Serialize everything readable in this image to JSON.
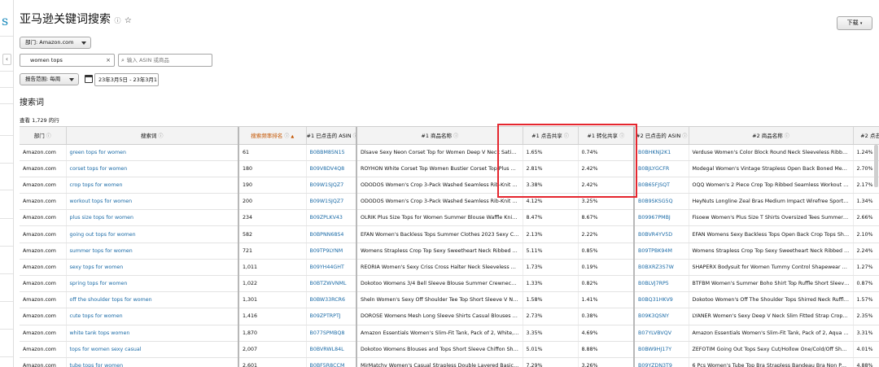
{
  "page": {
    "title": "亚马逊关键词搜索",
    "info_icon": "info-circle-icon",
    "star_icon": "star-outline-icon",
    "download_label": "下载",
    "sidebar_logo": "s"
  },
  "filters": {
    "department_label": "部门: Amazon.com",
    "search_value": "women tops",
    "asin_placeholder": "输入 ASIN 或商品",
    "report_range_label": "报告范围: 每周",
    "date_range": "23年3月5日 - 23年3月1"
  },
  "section": {
    "title": "搜索词",
    "count": "查看 1,729 的行"
  },
  "table": {
    "headers": [
      "部门",
      "搜索词",
      "搜索频率排名",
      "#1 已点击的 ASIN",
      "#1 商品名称",
      "#1 点击共享",
      "#1 转化共享",
      "#2 已点击的 ASIN",
      "#2 商品名称",
      "#2 点击共享"
    ],
    "rows": [
      [
        "Amazon.com",
        "green tops for women",
        "61",
        "B0BBM85N15",
        "Dlsave Sexy Neon Corset Top for Women Deep V Neck Satin B...",
        "1.65%",
        "0.74%",
        "B0BHKNJ2K1",
        "Verduse Women's Color Block Round Neck Sleeveless Ribbed ...",
        "1.24%"
      ],
      [
        "Amazon.com",
        "corset tops for women",
        "180",
        "B09V8DV4Q8",
        "ROYHON White Corset Top Women Bustier Corset Top Plus Si...",
        "2.81%",
        "2.42%",
        "B0BJLYGCFR",
        "Modegal Women's Vintage Strapless Open Back Boned Mesh B...",
        "2.70%"
      ],
      [
        "Amazon.com",
        "crop tops for women",
        "190",
        "B09W1SJQZ7",
        "ODODOS Women's Crop 3-Pack Washed Seamless Rib-Knit Ca...",
        "3.38%",
        "2.42%",
        "B0B65FJSQT",
        "OQQ Women's 2 Piece Crop Top Ribbed Seamless Workout Ex...",
        "2.17%"
      ],
      [
        "Amazon.com",
        "workout tops for women",
        "200",
        "B09W1SJQZ7",
        "ODODOS Women's Crop 3-Pack Washed Seamless Rib-Knit Ca...",
        "4.12%",
        "3.25%",
        "B0B9SKSG5Q",
        "HeyNuts Longline Zeal Bras Medium Impact Wirefree Sports B...",
        "1.34%"
      ],
      [
        "Amazon.com",
        "plus size tops for women",
        "234",
        "B09ZPLKV43",
        "OLRIK Plus Size Tops for Women Summer Blouse Waffle Knit ...",
        "8.47%",
        "8.67%",
        "B09967PMBJ",
        "Fisoew Women's Plus Size T Shirts Oversized Tees Summer Ha...",
        "2.66%"
      ],
      [
        "Amazon.com",
        "going out tops for women",
        "582",
        "B0BPNN68S4",
        "EFAN Women's Backless Tops Summer Clothes 2023 Sexy Cut...",
        "2.13%",
        "2.22%",
        "B0BVR4YV5D",
        "EFAN Womens Sexy Backless Tops Open Back Crop Tops Short...",
        "2.10%"
      ],
      [
        "Amazon.com",
        "summer tops for women",
        "721",
        "B09TP9LYNM",
        "Womens Strapless Crop Top Sexy Sweetheart Neck Ribbed Kni...",
        "5.11%",
        "0.85%",
        "B09TPBK94M",
        "Womens Strapless Crop Top Sexy Sweetheart Neck Ribbed Kni...",
        "2.24%"
      ],
      [
        "Amazon.com",
        "sexy tops for women",
        "1,011",
        "B09YH44GHT",
        "REORIA Women's Sexy Criss Cross Halter Neck Sleeveless Tho...",
        "1.73%",
        "0.19%",
        "B0BXRZ3S7W",
        "SHAPERX Bodysuit for Women Tummy Control Shapewear Se...",
        "1.27%"
      ],
      [
        "Amazon.com",
        "spring tops for women",
        "1,022",
        "B0BTZWVNML",
        "Dokotoo Womens 3/4 Bell Sleeve Blouse Summer Crewneck L...",
        "1.33%",
        "0.82%",
        "B0BLVJ7RP5",
        "BTFBM Women's Summer Boho Shirt Top Ruffle Short Sleeve ...",
        "0.87%"
      ],
      [
        "Amazon.com",
        "off the shoulder tops for women",
        "1,301",
        "B0BW33RCR6",
        "Sheln Women's Sexy Off Shoulder Tee Top Short Sleeve V Ne...",
        "1.58%",
        "1.41%",
        "B0BQ31HKV9",
        "Dokotoo Women's Off The Shoulder Tops Shirred Neck Ruffle ...",
        "1.57%"
      ],
      [
        "Amazon.com",
        "cute tops for women",
        "1,416",
        "B09ZPTRPTJ",
        "DOROSE Womens Mesh Long Sleeve Shirts Casual Blouses Tops",
        "2.73%",
        "0.38%",
        "B09K3QSNY",
        "LYANER Women's Sexy Deep V Neck Slim Fitted Strap Crop Ca...",
        "2.35%"
      ],
      [
        "Amazon.com",
        "white tank tops women",
        "1,870",
        "B077SPMBQ8",
        "Amazon Essentials Women's Slim-Fit Tank, Pack of 2, White, X...",
        "3.35%",
        "4.69%",
        "B07YLVBVQV",
        "Amazon Essentials Women's Slim-Fit Tank, Pack of 2, Aqua Blu...",
        "3.31%"
      ],
      [
        "Amazon.com",
        "tops for women sexy casual",
        "2,007",
        "B0BVRWL84L",
        "Dokotoo Womens Blouses and Tops Short Sleeve Chiffon Shirt...",
        "5.01%",
        "8.88%",
        "B0BW9HJ17Y",
        "ZEFOTIM Going Out Tops Sexy Cut/Hollow One/Cold/Off Sho...",
        "4.01%"
      ],
      [
        "Amazon.com",
        "tube tops for women",
        "2,601",
        "B0BF5R8CCM",
        "MirMatchy Women's Casual Strapless Double Layered Basic Se...",
        "7.29%",
        "3.26%",
        "B09YZDN3T9",
        "6 Pcs Women's Tube Top Bra Strapless Bandeau Bra Non Padd...",
        "4.88%"
      ]
    ]
  },
  "colors": {
    "accent_sort": "#c45500",
    "link": "#1a6aa6",
    "highlight_box": "#e5262e"
  }
}
